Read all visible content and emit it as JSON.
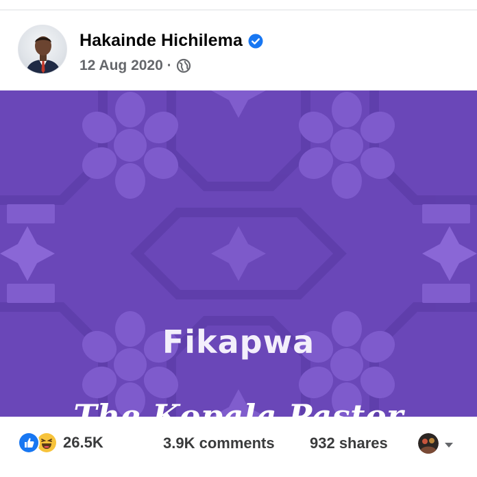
{
  "post": {
    "author_name": "Hakainde Hichilema",
    "date": "12 Aug 2020 ·",
    "image": {
      "headline": "Fikapwa",
      "signature": "The Kopala Pastor",
      "background_color": "#6a47b8",
      "pattern_color": "#7f5dc9"
    },
    "reactions": {
      "icons": [
        "like-icon",
        "haha-icon"
      ],
      "count": "26.5K"
    },
    "comments": "3.9K comments",
    "shares": "932 shares"
  },
  "colors": {
    "brand_blue": "#1877f2",
    "text": "#050505",
    "secondary_text": "#65676b"
  }
}
